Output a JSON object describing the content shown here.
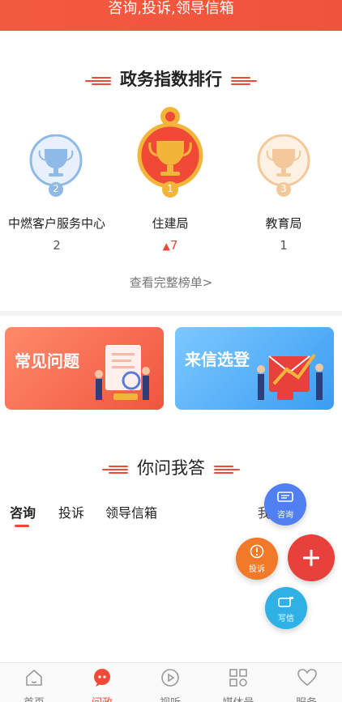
{
  "banner": {
    "text": "咨询,投诉,领导信箱"
  },
  "ranking": {
    "title": "政务指数排行",
    "items": [
      {
        "rank": "2",
        "name": "中燃客户服务中心",
        "score": "2"
      },
      {
        "rank": "1",
        "name": "住建局",
        "score": "7"
      },
      {
        "rank": "3",
        "name": "教育局",
        "score": "1"
      }
    ],
    "view_all": "查看完整榜单>"
  },
  "cards": {
    "faq": "常见问题",
    "letters": "来信选登"
  },
  "qa": {
    "title": "你问我答",
    "tabs": [
      "咨询",
      "投诉",
      "领导信箱"
    ],
    "more": "我  政>"
  },
  "fabs": {
    "consult": "咨询",
    "complain": "投诉",
    "write": "写信"
  },
  "nav": {
    "items": [
      "首页",
      "问政",
      "视听",
      "媒体号",
      "服务"
    ]
  },
  "colors": {
    "accent": "#f04a36",
    "gold": "#f2b53a",
    "silver": "#8fb9e6",
    "bronze": "#f3c99b",
    "blue_fab": "#4f7ff0",
    "orange_fab": "#f07a2a",
    "cyan_fab": "#2fb1e6"
  }
}
